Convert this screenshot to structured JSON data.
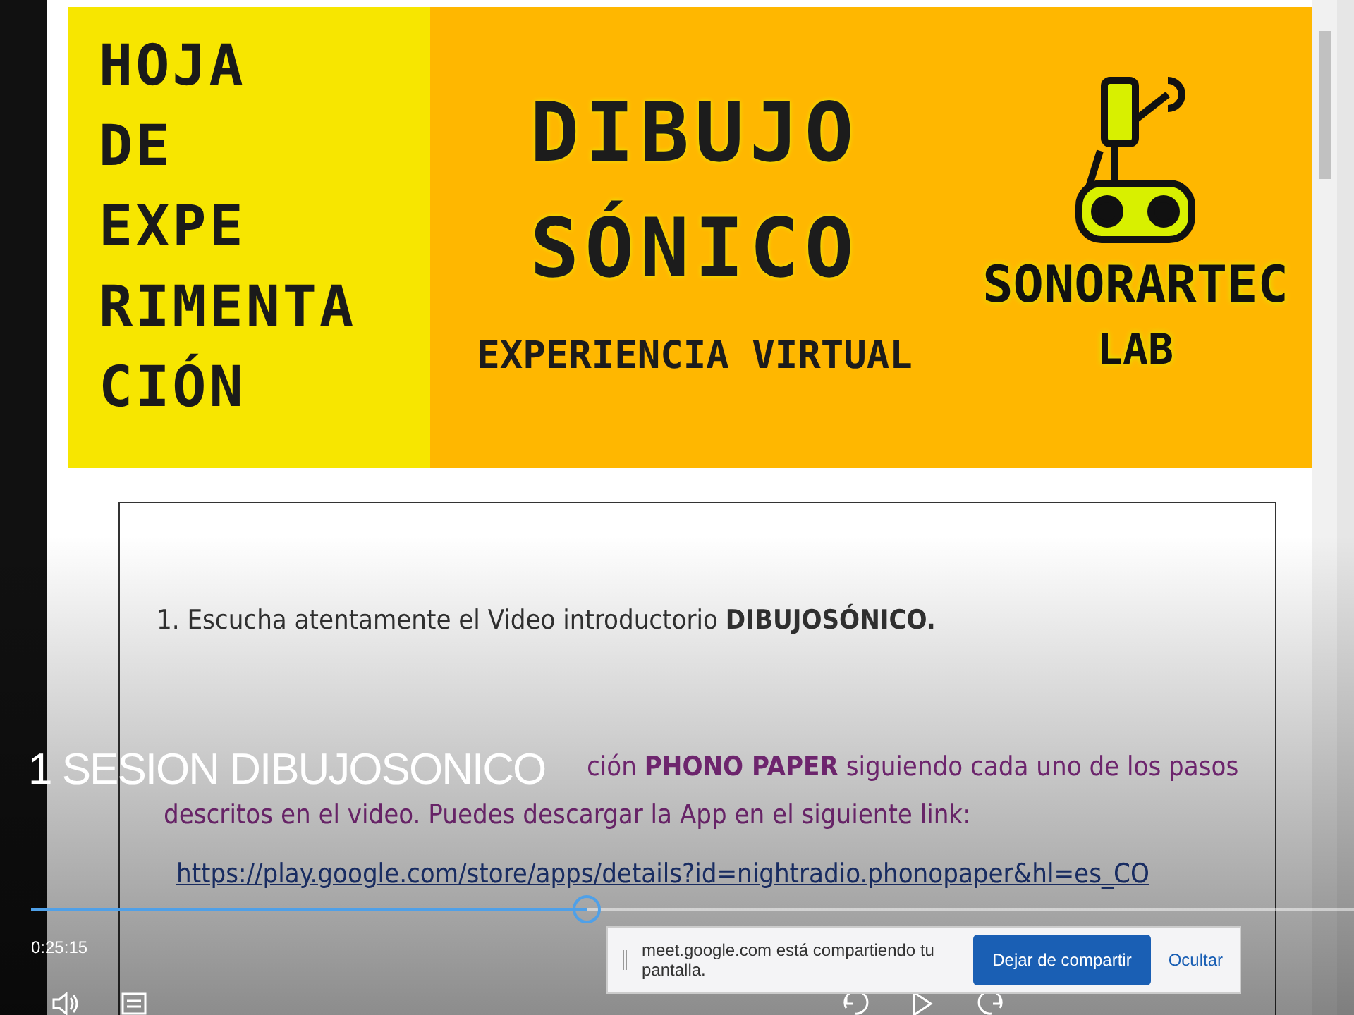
{
  "header": {
    "side_title_lines": [
      "HOJA",
      "DE",
      "EXPE",
      "RIMENTA",
      "CIÓN"
    ],
    "title_lines": [
      "DIBUJO",
      "SÓNICO"
    ],
    "subtitle": "EXPERIENCIA VIRTUAL",
    "logo_lines": [
      "SONORARTEC",
      "LAB"
    ]
  },
  "steps": [
    {
      "kind": "plain",
      "text": "1. Escucha atentamente el Video introductorio **DIBUJOSÓNICO.**"
    },
    {
      "kind": "highlight",
      "lines": [
        "ción **PHONO PAPER** siguiendo cada uno de los pasos",
        "descritos en el video. Puedes descargar la App en el siguiente link:"
      ]
    },
    {
      "kind": "link",
      "text": "https://play.google.com/store/apps/details?id=nightradio.phonopaper&hl=es_CO"
    }
  ],
  "player": {
    "title": "1 SESION DIBUJOSONICO",
    "elapsed": "0:25:15",
    "progress": {
      "level": 0.42
    }
  },
  "share_bar": {
    "message": "meet.google.com está compartiendo tu pantalla.",
    "stop_button": "Dejar de compartir",
    "hide_button": "Ocultar"
  }
}
